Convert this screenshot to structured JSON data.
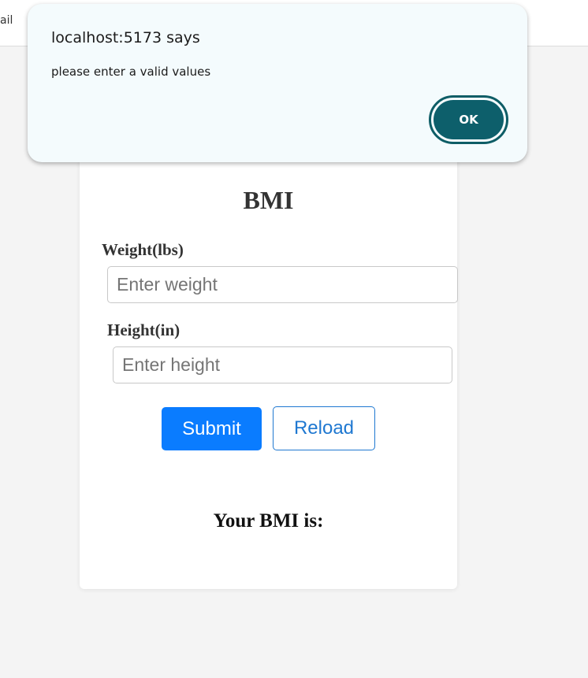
{
  "browser": {
    "partial_tab_text": "ail"
  },
  "app": {
    "title": "BMI",
    "weight": {
      "label": "Weight(lbs)",
      "value": "",
      "placeholder": "Enter weight"
    },
    "height": {
      "label": "Height(in)",
      "value": "",
      "placeholder": "Enter height"
    },
    "submit_label": "Submit",
    "reload_label": "Reload",
    "result_label": "Your BMI is:"
  },
  "alert": {
    "title": "localhost:5173 says",
    "message": "please enter a valid values",
    "ok_label": "OK"
  },
  "colors": {
    "submit": "#0a7cff",
    "reload": "#1f78d1",
    "ok": "#0d5f6b",
    "dialog_bg": "#f4fbfd"
  }
}
